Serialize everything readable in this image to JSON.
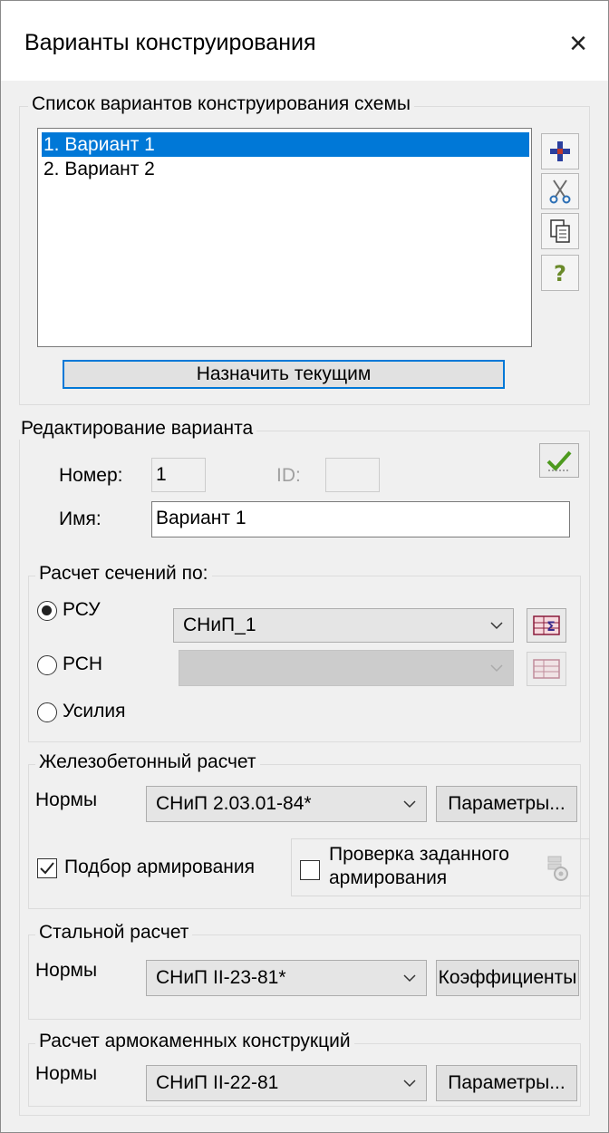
{
  "window": {
    "title": "Варианты конструирования",
    "close_glyph": "×"
  },
  "variants_group": {
    "legend": "Список вариантов конструирования схемы",
    "items": [
      "1. Вариант 1",
      "2. Вариант 2"
    ],
    "selected_index": 0,
    "tools": [
      "plus-icon",
      "scissors-icon",
      "copy-icon",
      "help-icon"
    ],
    "tool_glyphs": {
      "help": "?"
    },
    "assign_button": "Назначить текущим"
  },
  "edit_group": {
    "legend": "Редактирование варианта",
    "number_label": "Номер:",
    "number_value": "1",
    "id_label": "ID:",
    "id_value": "",
    "name_label": "Имя:",
    "name_value": "Вариант 1",
    "apply_icon": "checkmark-icon"
  },
  "section_calc": {
    "legend": "Расчет сечений по:",
    "options": [
      {
        "label": "РСУ",
        "checked": true,
        "combo": "СНиП_1",
        "enabled": true
      },
      {
        "label": "РСН",
        "checked": false,
        "combo": "",
        "enabled": false
      },
      {
        "label": "Усилия",
        "checked": false
      }
    ],
    "icon_glyph": "Σ"
  },
  "rc_calc": {
    "legend": "Железобетонный  расчет",
    "norms_label": "Нормы",
    "norms_value": "СНиП 2.03.01-84*",
    "params_button": "Параметры...",
    "reinforcement_selection": {
      "label": "Подбор армирования",
      "checked": true
    },
    "check_reinforcement": {
      "label_line1": "Проверка заданного",
      "label_line2": "армирования",
      "checked": false
    },
    "settings_icon": "gear-icon"
  },
  "steel_calc": {
    "legend": "Стальной расчет",
    "norms_label": "Нормы",
    "norms_value": "СНиП II-23-81*",
    "coefficients_button": "Коэффициенты"
  },
  "masonry_calc": {
    "legend": "Расчет армокаменных конструкций",
    "norms_label": "Нормы",
    "norms_value": "СНиП II-22-81",
    "params_button": "Параметры..."
  },
  "colors": {
    "accent": "#0078d7",
    "dialog_bg": "#f0f0f0"
  }
}
